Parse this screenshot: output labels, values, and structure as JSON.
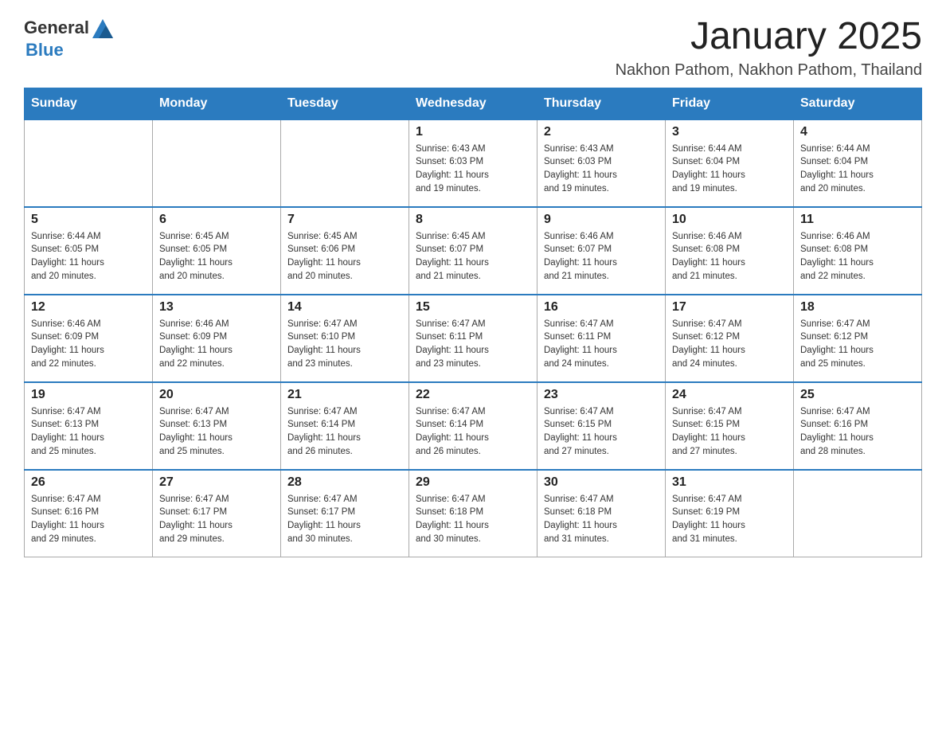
{
  "header": {
    "logo_general": "General",
    "logo_blue": "Blue",
    "month_year": "January 2025",
    "location": "Nakhon Pathom, Nakhon Pathom, Thailand"
  },
  "days_of_week": [
    "Sunday",
    "Monday",
    "Tuesday",
    "Wednesday",
    "Thursday",
    "Friday",
    "Saturday"
  ],
  "weeks": [
    {
      "days": [
        {
          "number": "",
          "info": ""
        },
        {
          "number": "",
          "info": ""
        },
        {
          "number": "",
          "info": ""
        },
        {
          "number": "1",
          "info": "Sunrise: 6:43 AM\nSunset: 6:03 PM\nDaylight: 11 hours\nand 19 minutes."
        },
        {
          "number": "2",
          "info": "Sunrise: 6:43 AM\nSunset: 6:03 PM\nDaylight: 11 hours\nand 19 minutes."
        },
        {
          "number": "3",
          "info": "Sunrise: 6:44 AM\nSunset: 6:04 PM\nDaylight: 11 hours\nand 19 minutes."
        },
        {
          "number": "4",
          "info": "Sunrise: 6:44 AM\nSunset: 6:04 PM\nDaylight: 11 hours\nand 20 minutes."
        }
      ]
    },
    {
      "days": [
        {
          "number": "5",
          "info": "Sunrise: 6:44 AM\nSunset: 6:05 PM\nDaylight: 11 hours\nand 20 minutes."
        },
        {
          "number": "6",
          "info": "Sunrise: 6:45 AM\nSunset: 6:05 PM\nDaylight: 11 hours\nand 20 minutes."
        },
        {
          "number": "7",
          "info": "Sunrise: 6:45 AM\nSunset: 6:06 PM\nDaylight: 11 hours\nand 20 minutes."
        },
        {
          "number": "8",
          "info": "Sunrise: 6:45 AM\nSunset: 6:07 PM\nDaylight: 11 hours\nand 21 minutes."
        },
        {
          "number": "9",
          "info": "Sunrise: 6:46 AM\nSunset: 6:07 PM\nDaylight: 11 hours\nand 21 minutes."
        },
        {
          "number": "10",
          "info": "Sunrise: 6:46 AM\nSunset: 6:08 PM\nDaylight: 11 hours\nand 21 minutes."
        },
        {
          "number": "11",
          "info": "Sunrise: 6:46 AM\nSunset: 6:08 PM\nDaylight: 11 hours\nand 22 minutes."
        }
      ]
    },
    {
      "days": [
        {
          "number": "12",
          "info": "Sunrise: 6:46 AM\nSunset: 6:09 PM\nDaylight: 11 hours\nand 22 minutes."
        },
        {
          "number": "13",
          "info": "Sunrise: 6:46 AM\nSunset: 6:09 PM\nDaylight: 11 hours\nand 22 minutes."
        },
        {
          "number": "14",
          "info": "Sunrise: 6:47 AM\nSunset: 6:10 PM\nDaylight: 11 hours\nand 23 minutes."
        },
        {
          "number": "15",
          "info": "Sunrise: 6:47 AM\nSunset: 6:11 PM\nDaylight: 11 hours\nand 23 minutes."
        },
        {
          "number": "16",
          "info": "Sunrise: 6:47 AM\nSunset: 6:11 PM\nDaylight: 11 hours\nand 24 minutes."
        },
        {
          "number": "17",
          "info": "Sunrise: 6:47 AM\nSunset: 6:12 PM\nDaylight: 11 hours\nand 24 minutes."
        },
        {
          "number": "18",
          "info": "Sunrise: 6:47 AM\nSunset: 6:12 PM\nDaylight: 11 hours\nand 25 minutes."
        }
      ]
    },
    {
      "days": [
        {
          "number": "19",
          "info": "Sunrise: 6:47 AM\nSunset: 6:13 PM\nDaylight: 11 hours\nand 25 minutes."
        },
        {
          "number": "20",
          "info": "Sunrise: 6:47 AM\nSunset: 6:13 PM\nDaylight: 11 hours\nand 25 minutes."
        },
        {
          "number": "21",
          "info": "Sunrise: 6:47 AM\nSunset: 6:14 PM\nDaylight: 11 hours\nand 26 minutes."
        },
        {
          "number": "22",
          "info": "Sunrise: 6:47 AM\nSunset: 6:14 PM\nDaylight: 11 hours\nand 26 minutes."
        },
        {
          "number": "23",
          "info": "Sunrise: 6:47 AM\nSunset: 6:15 PM\nDaylight: 11 hours\nand 27 minutes."
        },
        {
          "number": "24",
          "info": "Sunrise: 6:47 AM\nSunset: 6:15 PM\nDaylight: 11 hours\nand 27 minutes."
        },
        {
          "number": "25",
          "info": "Sunrise: 6:47 AM\nSunset: 6:16 PM\nDaylight: 11 hours\nand 28 minutes."
        }
      ]
    },
    {
      "days": [
        {
          "number": "26",
          "info": "Sunrise: 6:47 AM\nSunset: 6:16 PM\nDaylight: 11 hours\nand 29 minutes."
        },
        {
          "number": "27",
          "info": "Sunrise: 6:47 AM\nSunset: 6:17 PM\nDaylight: 11 hours\nand 29 minutes."
        },
        {
          "number": "28",
          "info": "Sunrise: 6:47 AM\nSunset: 6:17 PM\nDaylight: 11 hours\nand 30 minutes."
        },
        {
          "number": "29",
          "info": "Sunrise: 6:47 AM\nSunset: 6:18 PM\nDaylight: 11 hours\nand 30 minutes."
        },
        {
          "number": "30",
          "info": "Sunrise: 6:47 AM\nSunset: 6:18 PM\nDaylight: 11 hours\nand 31 minutes."
        },
        {
          "number": "31",
          "info": "Sunrise: 6:47 AM\nSunset: 6:19 PM\nDaylight: 11 hours\nand 31 minutes."
        },
        {
          "number": "",
          "info": ""
        }
      ]
    }
  ]
}
